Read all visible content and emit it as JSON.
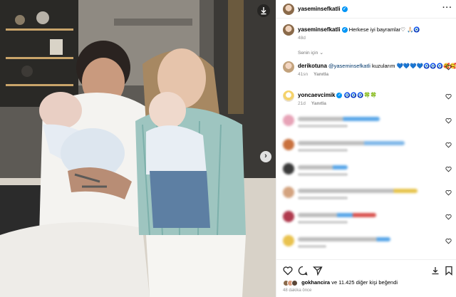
{
  "post": {
    "author": "yaseminsefkatli",
    "caption_text": "Herkese iyi bayramlar♡ 🙏🏻🧿",
    "caption_time": "48d"
  },
  "for_you_label": "Senin için",
  "comments": [
    {
      "username": "derikotuna",
      "mention": "@yaseminsefkatli",
      "text": "kuzularım",
      "emojis": "💙💙💙💙🧿🧿🧿🥰🥰🥰🥰",
      "time": "41sn",
      "reply_label": "Yanıtla"
    },
    {
      "username": "yoncaevcimik",
      "text": "",
      "emojis": "🧿🧿🧿🍀🍀",
      "time": "21d",
      "reply_label": "Yanıtla"
    }
  ],
  "likes": {
    "user": "gokhancira",
    "text": "ve 11.425 diğer kişi beğendi"
  },
  "timestamp": "48 dakika önce",
  "colors": {
    "verified": "#0095f6",
    "meta": "#8e8e8e",
    "mention": "#00376b"
  },
  "icons": [
    "save-icon",
    "next-arrow-icon",
    "more-options-icon",
    "heart-icon",
    "comment-icon",
    "share-icon",
    "bookmark-icon"
  ]
}
